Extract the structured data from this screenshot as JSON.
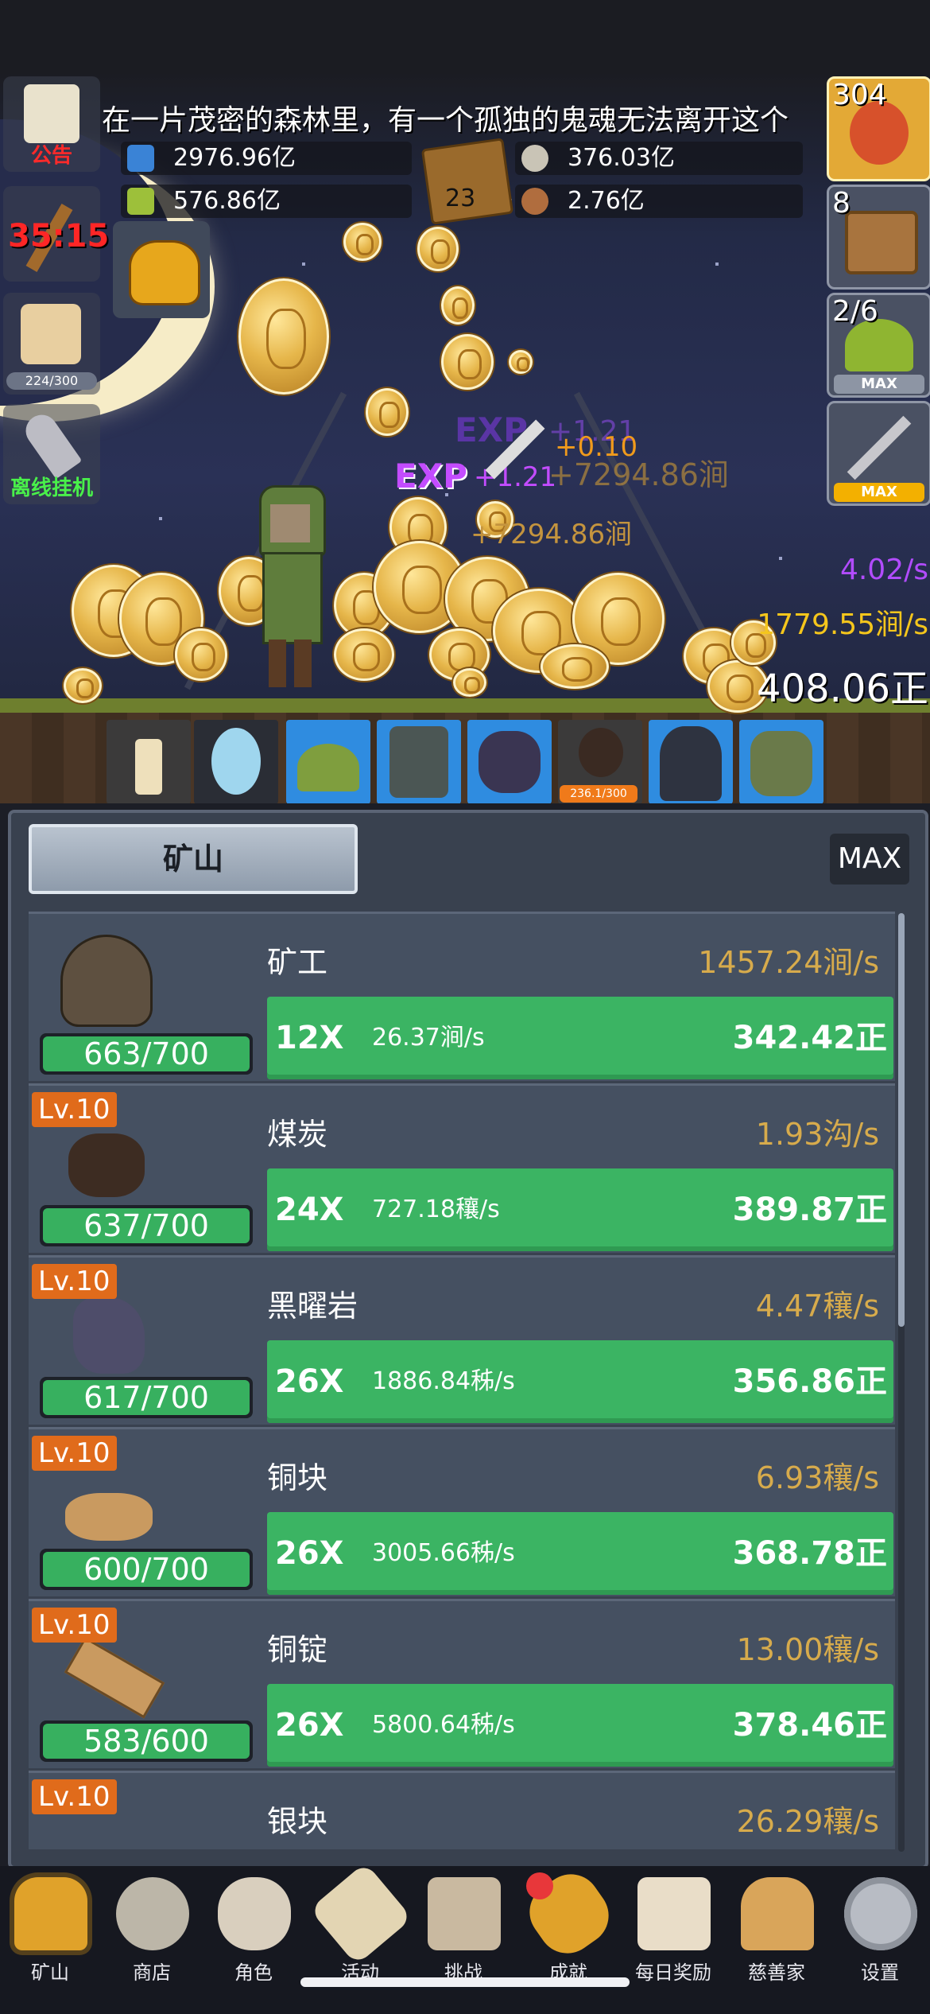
{
  "story_text": "在一片茂密的森林里，有一个孤独的鬼魂无法离开这个",
  "left_buttons": {
    "notice": "公告",
    "timer": "35:15",
    "food_progress": "224/300",
    "offline": "离线挂机"
  },
  "resources": {
    "blue_potion": "2976.96亿",
    "green_potion": "576.86亿",
    "book_count": "23",
    "stone": "376.03亿",
    "meat": "2.76亿"
  },
  "right_buttons": {
    "potion_count": "304",
    "chest_count": "8",
    "slime_count": "2/6",
    "slime_tag": "MAX",
    "sword_tag": "MAX"
  },
  "floating": {
    "exp1": "EXP",
    "exp1_val": "+1.21",
    "exp2": "EXP",
    "exp2_val": "+1.21",
    "plus_gold": "+0.10",
    "gain1": "+7294.86涧",
    "gain2": "+7294.86涧"
  },
  "stats": {
    "rate_purple": "4.02/s",
    "rate_gold": "1779.55涧/s",
    "total": "408.06正"
  },
  "monster_strip": {
    "boss_progress": "236.1/300"
  },
  "panel": {
    "tab": "矿山",
    "max": "MAX",
    "rows": [
      {
        "level": "",
        "name": "矿工",
        "rate": "1457.24涧/s",
        "count": "663/700",
        "mult": "12X",
        "sub": "26.37涧/s",
        "value": "342.42正"
      },
      {
        "level": "Lv.10",
        "name": "煤炭",
        "rate": "1.93沟/s",
        "count": "637/700",
        "mult": "24X",
        "sub": "727.18穰/s",
        "value": "389.87正"
      },
      {
        "level": "Lv.10",
        "name": "黑曜岩",
        "rate": "4.47穰/s",
        "count": "617/700",
        "mult": "26X",
        "sub": "1886.84秭/s",
        "value": "356.86正"
      },
      {
        "level": "Lv.10",
        "name": "铜块",
        "rate": "6.93穰/s",
        "count": "600/700",
        "mult": "26X",
        "sub": "3005.66秭/s",
        "value": "368.78正"
      },
      {
        "level": "Lv.10",
        "name": "铜锭",
        "rate": "13.00穰/s",
        "count": "583/600",
        "mult": "26X",
        "sub": "5800.64秭/s",
        "value": "378.46正"
      },
      {
        "level": "Lv.10",
        "name": "银块",
        "rate": "26.29穰/s",
        "count": "",
        "mult": "",
        "sub": "",
        "value": ""
      }
    ]
  },
  "nav": [
    "矿山",
    "商店",
    "角色",
    "活动",
    "挑战",
    "成就",
    "每日奖励",
    "慈善家",
    "设置"
  ],
  "colors": {
    "accent_green": "#3bb463",
    "gold_text": "#d7ab4c",
    "level_orange": "#e06b1b",
    "purple_text": "#b24cff"
  }
}
